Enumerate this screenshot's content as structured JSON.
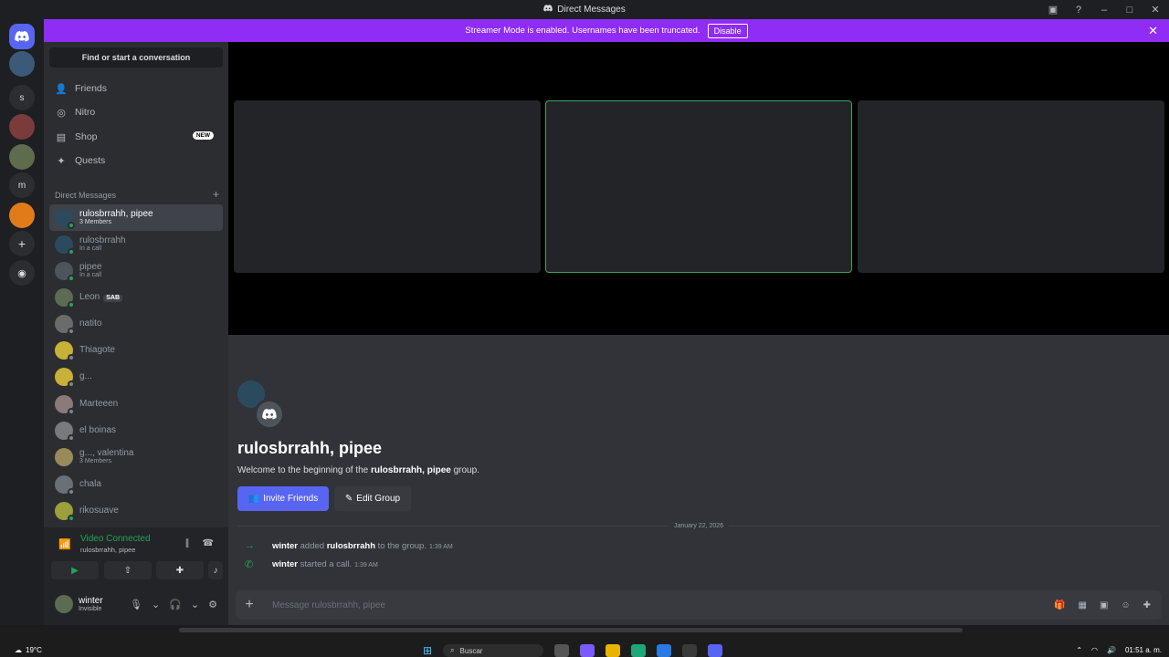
{
  "window": {
    "title": "Direct Messages"
  },
  "banner": {
    "text": "Streamer Mode is enabled. Usernames have been truncated.",
    "disable_label": "Disable"
  },
  "guilds": [
    {
      "label": ""
    },
    {
      "label": ""
    },
    {
      "label": "s"
    },
    {
      "label": ""
    },
    {
      "label": ""
    },
    {
      "label": "m"
    },
    {
      "label": ""
    },
    {
      "label": "+"
    },
    {
      "label": ""
    }
  ],
  "sidebar": {
    "search_label": "Find or start a conversation",
    "nav": [
      {
        "label": "Friends",
        "icon": "friends-icon"
      },
      {
        "label": "Nitro",
        "icon": "nitro-icon"
      },
      {
        "label": "Shop",
        "icon": "shop-icon",
        "badge": "NEW"
      },
      {
        "label": "Quests",
        "icon": "quests-icon"
      }
    ],
    "dm_header": "Direct Messages",
    "dm_add": "+",
    "dms": [
      {
        "name": "rulosbrrahh, pipee",
        "sub": "3 Members",
        "active": true
      },
      {
        "name": "rulosbrrahh",
        "sub": "In a call"
      },
      {
        "name": "pipee",
        "sub": "In a call"
      },
      {
        "name": "Leon",
        "tag": "SAB"
      },
      {
        "name": "natito"
      },
      {
        "name": "Thiagote"
      },
      {
        "name": "g..."
      },
      {
        "name": "Marteeen"
      },
      {
        "name": "el boinas"
      },
      {
        "name": "g..., valentina",
        "sub": "3 Members"
      },
      {
        "name": "chala"
      },
      {
        "name": "rikosuave"
      }
    ]
  },
  "voice": {
    "status": "Video Connected",
    "channel": "rulosbrrahh, pipee"
  },
  "user": {
    "name": "winter",
    "status": "Invisible"
  },
  "group": {
    "title": "rulosbrrahh, pipee",
    "welcome_prefix": "Welcome to the beginning of the ",
    "welcome_name": "rulosbrrahh, pipee",
    "welcome_suffix": " group.",
    "invite_label": "Invite Friends",
    "edit_label": "Edit Group"
  },
  "messages": {
    "date": "January 22, 2026",
    "items": [
      {
        "actor": "winter",
        "text1": " added ",
        "target": "rulosbrrahh",
        "text2": " to the group.",
        "time": "1:39 AM"
      },
      {
        "actor": "winter",
        "text1": " started a call.",
        "target": "",
        "text2": "",
        "time": "1:39 AM"
      }
    ]
  },
  "composer": {
    "placeholder": "Message rulosbrrahh, pipee"
  },
  "taskbar": {
    "weather": "19°C",
    "search": "Buscar",
    "time": "01:51 a. m."
  },
  "colors": {
    "accent": "#5865f2",
    "banner": "#8f2cf5",
    "online": "#23a55a"
  }
}
